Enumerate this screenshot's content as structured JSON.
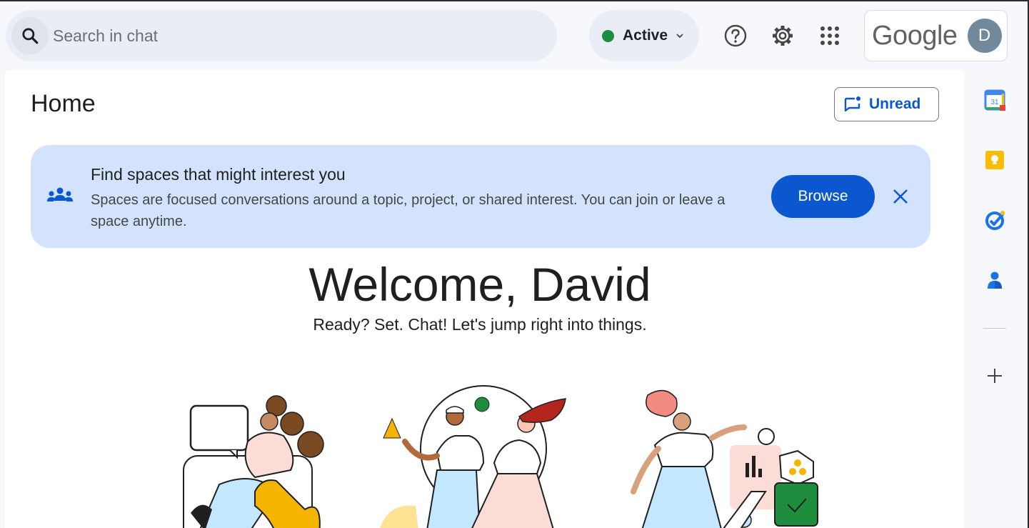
{
  "search": {
    "placeholder": "Search in chat",
    "icon": "search-icon"
  },
  "status": {
    "label": "Active",
    "color": "#1e8e3e"
  },
  "header_icons": [
    "help-icon",
    "settings-icon",
    "apps-icon"
  ],
  "account": {
    "brand": "Google",
    "avatar_initial": "D"
  },
  "main": {
    "title": "Home",
    "unread_label": "Unread",
    "banner": {
      "title": "Find spaces that might interest you",
      "text": "Spaces are focused conversations around a topic, project, or shared interest. You can join or leave a space anytime.",
      "browse_label": "Browse"
    },
    "welcome": "Welcome, David",
    "tagline": "Ready? Set. Chat! Let's jump right into things."
  },
  "side_apps": [
    "calendar-icon",
    "keep-icon",
    "tasks-icon",
    "contacts-icon",
    "add-icon"
  ],
  "calendar_day": "31",
  "colors": {
    "accent": "#0b57d0",
    "banner": "#d3e3fd",
    "background": "#f6f8fc"
  }
}
